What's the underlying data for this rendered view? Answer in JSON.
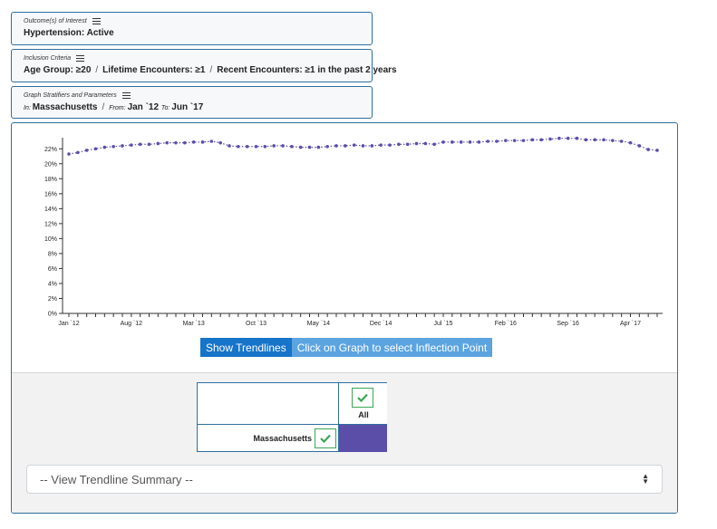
{
  "criteria": {
    "outcome": {
      "label": "Outcome(s) of Interest",
      "value": "Hypertension: Active"
    },
    "inclusion": {
      "label": "Inclusion Criteria",
      "items": [
        "Age Group: ≥20",
        "Lifetime Encounters: ≥1",
        "Recent Encounters: ≥1 in the past 2 years"
      ],
      "separator": "/"
    },
    "stratifiers": {
      "label": "Graph Stratifiers and Parameters",
      "in_label": "In:",
      "location": "Massachusetts",
      "separator": "/",
      "from_label": "From:",
      "from": "Jan `12",
      "to_label": "To:",
      "to": "Jun `17"
    }
  },
  "buttons": {
    "trendlines": "Show Trendlines",
    "inflection": "Click on Graph to select Inflection Point"
  },
  "table": {
    "column_label": "All",
    "row_label": "Massachusetts",
    "fill_color": "#5b4ea8",
    "check_color": "#3aa655"
  },
  "summary_select": {
    "value": "-- View Trendline Summary --"
  },
  "colors": {
    "accent": "#1674c9",
    "border": "#2f6f9f",
    "series": "#5b4ea8"
  },
  "chart_data": {
    "type": "line",
    "ylim": [
      0,
      23
    ],
    "y_ticks": [
      0,
      2,
      4,
      6,
      8,
      10,
      12,
      14,
      16,
      18,
      20,
      22
    ],
    "y_tick_labels": [
      "0%",
      "2%",
      "4%",
      "6%",
      "8%",
      "10%",
      "12%",
      "14%",
      "16%",
      "18%",
      "20%",
      "22%"
    ],
    "x_tick_labels": [
      "Jan `12",
      "Aug `12",
      "Mar `13",
      "Oct `13",
      "May `14",
      "Dec `14",
      "Jul `15",
      "Feb `16",
      "Sep `16",
      "Apr `17"
    ],
    "x_tick_label_index": [
      0,
      7,
      14,
      21,
      28,
      35,
      42,
      49,
      56,
      63
    ],
    "series": [
      {
        "values": [
          21.3,
          21.5,
          21.8,
          22.0,
          22.2,
          22.3,
          22.4,
          22.5,
          22.6,
          22.6,
          22.7,
          22.8,
          22.8,
          22.8,
          22.9,
          22.9,
          23.0,
          22.8,
          22.4,
          22.3,
          22.3,
          22.3,
          22.3,
          22.4,
          22.4,
          22.3,
          22.2,
          22.2,
          22.2,
          22.3,
          22.4,
          22.4,
          22.5,
          22.4,
          22.4,
          22.5,
          22.5,
          22.6,
          22.6,
          22.7,
          22.7,
          22.6,
          22.9,
          22.9,
          22.9,
          22.9,
          22.9,
          23.0,
          23.0,
          23.1,
          23.1,
          23.1,
          23.2,
          23.2,
          23.3,
          23.4,
          23.4,
          23.4,
          23.2,
          23.2,
          23.2,
          23.1,
          23.0,
          22.8,
          22.4,
          21.9,
          21.8
        ]
      }
    ]
  }
}
